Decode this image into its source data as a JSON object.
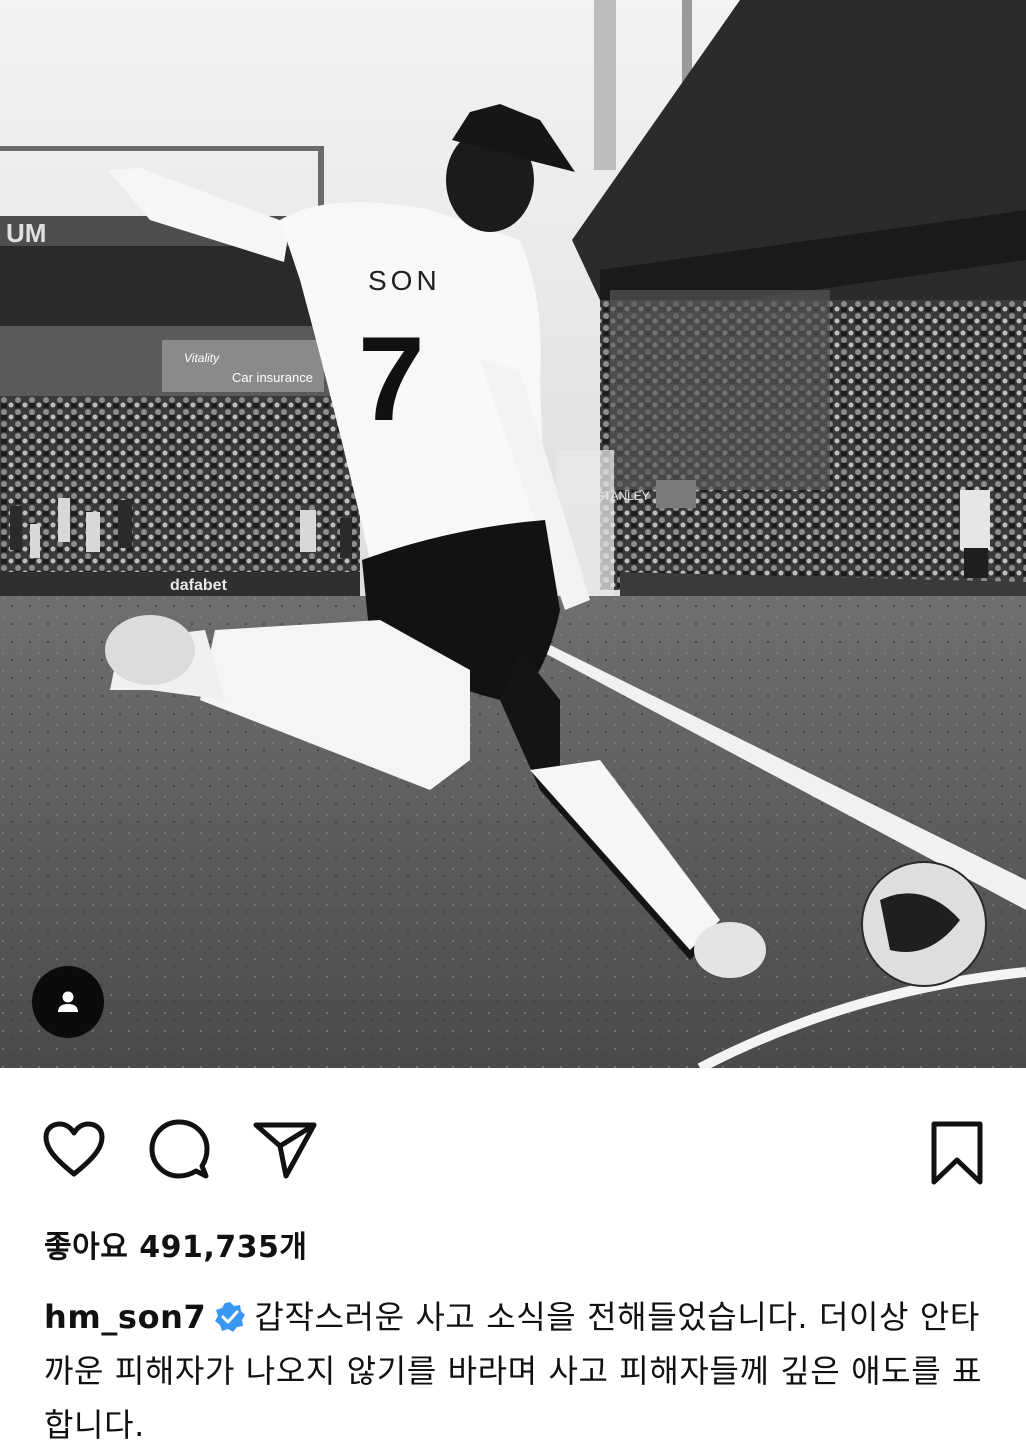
{
  "post": {
    "image_alt": "",
    "likes_label": "좋아요 491,735개",
    "username": "hm_son7",
    "caption_text": "갑작스러운 사고 소식을 전해들었습니다. 더이상 안타까운 피해자가 나오지 않기를 바라며 사고 피해자들께 깊은 애도를 표합니다.",
    "verified": true
  },
  "icons": {
    "tag": "person-tag-icon",
    "like": "heart-icon",
    "comment": "comment-bubble-icon",
    "share": "paper-plane-icon",
    "save": "bookmark-icon",
    "verified": "verified-badge-icon"
  },
  "colors": {
    "verified_blue": "#3897f0",
    "text": "#111111"
  },
  "photo_signage": {
    "stadium_letters": "UM",
    "shirt_name": "SON",
    "shirt_number": "7",
    "ad_board": "Car insurance",
    "ad_brand": "Vitality",
    "sponsor": "dafabet",
    "stand_sign": "STANLEY"
  }
}
